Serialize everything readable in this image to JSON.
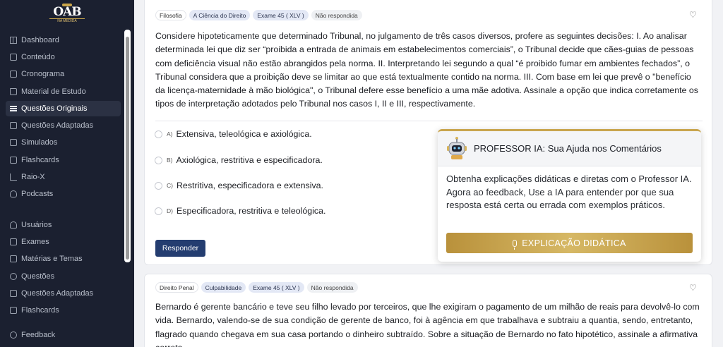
{
  "logo": {
    "main": "OAB",
    "sub": "NA MEDIDA"
  },
  "sidebar": {
    "items": [
      {
        "label": "Dashboard",
        "icon": "dashboard-icon"
      },
      {
        "label": "Conteúdo",
        "icon": "content-icon"
      },
      {
        "label": "Cronograma",
        "icon": "calendar-icon"
      },
      {
        "label": "Material de Estudo",
        "icon": "folder-icon"
      },
      {
        "label": "Questões Originais",
        "icon": "list-icon",
        "active": true
      },
      {
        "label": "Questões Adaptadas",
        "icon": "edit-icon"
      },
      {
        "label": "Simulados",
        "icon": "document-icon"
      },
      {
        "label": "Flashcards",
        "icon": "cards-icon"
      },
      {
        "label": "Raio-X",
        "icon": "chart-icon"
      },
      {
        "label": "Podcasts",
        "icon": "mic-icon"
      },
      {
        "label": "Usuários",
        "icon": "users-icon"
      },
      {
        "label": "Exames",
        "icon": "exam-icon"
      },
      {
        "label": "Matérias e Temas",
        "icon": "subjects-icon"
      },
      {
        "label": "Questões",
        "icon": "questions-icon"
      },
      {
        "label": "Questões Adaptadas",
        "icon": "edit-icon"
      },
      {
        "label": "Flashcards",
        "icon": "cards-icon"
      },
      {
        "label": "Feedback",
        "icon": "chat-icon"
      }
    ]
  },
  "question1": {
    "tags": [
      "Filosofia",
      "A Ciência do Direito",
      "Exame 45 ( XLV )",
      "Não respondida"
    ],
    "text": "Considere hipoteticamente que determinado Tribunal, no julgamento de três casos diversos, profere as seguintes decisões: I. Ao analisar determinada lei que diz ser “proibida a entrada de animais em estabelecimentos comerciais”, o Tribunal decide que cães-guias de pessoas com deficiência visual não estão abrangidos pela norma. II. Interpretando lei segundo a qual “é proibido fumar em ambientes fechados”, o Tribunal considera que a proibição deve se limitar ao que está textualmente contido na norma. III. Com base em lei que prevê o \"benefício da licença-maternidade à mão biológica\", o Tribunal defere esse benefício a uma mãe adotiva. Assinale a opção que indica corretamente os tipos de interpretação adotados pelo Tribunal nos casos I, II e III, respectivamente.",
    "options": [
      {
        "letter": "A)",
        "text": "Extensiva, teleológica e axiológica."
      },
      {
        "letter": "B)",
        "text": "Axiológica, restritiva e especificadora."
      },
      {
        "letter": "C)",
        "text": "Restritiva, especificadora e extensiva."
      },
      {
        "letter": "D)",
        "text": "Especificadora, restritiva e teleológica."
      }
    ],
    "answer_button": "Responder"
  },
  "popup": {
    "title": "PROFESSOR IA: Sua Ajuda nos Comentários",
    "body": "Obtenha explicações didáticas e diretas com o Professor IA. Agora ao feedback, Use a IA para entender por que sua resposta está certa ou errada com exemplos práticos.",
    "button": "EXPLICAÇÃO DIDÁTICA"
  },
  "question2": {
    "tags": [
      "Direito Penal",
      "Culpabilidade",
      "Exame 45 ( XLV )",
      "Não respondida"
    ],
    "text": "Bernardo é gerente bancário e teve seu filho levado por terceiros, que lhe exigiram o pagamento de um milhão de reais para devolvê-lo com vida. Bernardo, valendo-se de sua condição de gerente de banco, foi à agência em que trabalhava e subtraiu a quantia, sendo, entretanto, flagrado quando chegava em sua casa portando o dinheiro subtraído. Sobre a situação de Bernardo no fato hipotético, assinale a afirmativa correta."
  },
  "colors": {
    "sidebar_bg": "#1b2030",
    "primary": "#243d70",
    "gold": "#c9a54e"
  }
}
